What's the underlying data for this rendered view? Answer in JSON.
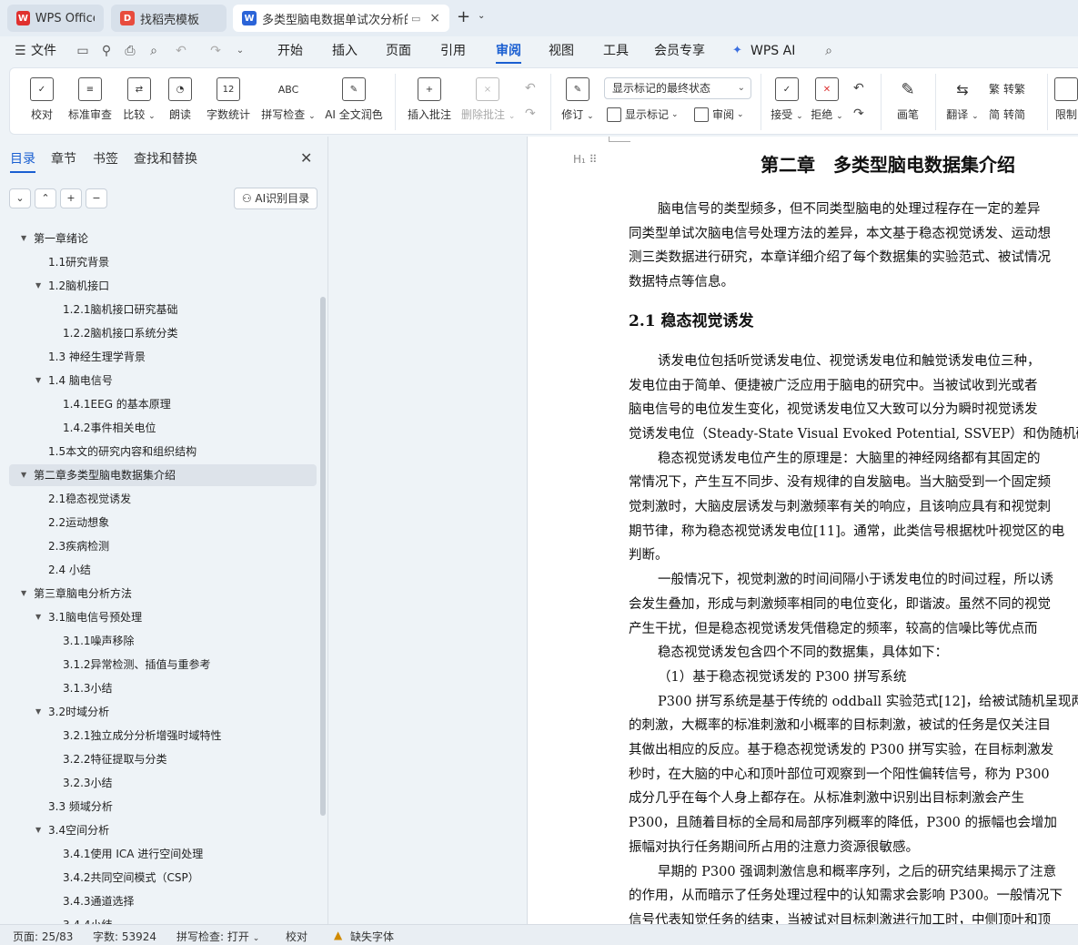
{
  "tabs": [
    {
      "label": "WPS Office",
      "icon": "wps-logo-icon"
    },
    {
      "label": "找稻壳模板",
      "icon": "docer-logo-icon"
    },
    {
      "label": "多类型脑电数据单试次分析的",
      "icon": "writer-doc-icon"
    }
  ],
  "menu": {
    "file": "文件",
    "items": [
      "开始",
      "插入",
      "页面",
      "引用",
      "审阅",
      "视图",
      "工具",
      "会员专享",
      "WPS AI"
    ],
    "active": "审阅"
  },
  "ribbon": {
    "proofread": "校对",
    "standard_review": "标准审查",
    "compare": "比较",
    "read_aloud": "朗读",
    "word_count": "字数统计",
    "spell_check": "拼写检查",
    "ai_polish": "AI 全文润色",
    "insert_comment": "插入批注",
    "delete_comment": "删除批注",
    "revise": "修订",
    "markup_mode": "显示标记的最终状态",
    "show_markup": "显示标记",
    "review": "审阅",
    "accept": "接受",
    "reject": "拒绝",
    "brush": "画笔",
    "translate": "翻译",
    "to_traditional": "转繁",
    "to_simplified": "转简",
    "restrict": "限制"
  },
  "nav": {
    "tabs": [
      "目录",
      "章节",
      "书签",
      "查找和替换"
    ],
    "ai_toc": "AI识别目录",
    "toc": [
      "第一章绪论",
      "1.1研究背景",
      "1.2脑机接口",
      "1.2.1脑机接口研究基础",
      "1.2.2脑机接口系统分类",
      "1.3  神经生理学背景",
      "1.4  脑电信号",
      "1.4.1EEG 的基本原理",
      "1.4.2事件相关电位",
      "1.5本文的研究内容和组织结构",
      "第二章多类型脑电数据集介绍",
      "2.1稳态视觉诱发",
      "2.2运动想象",
      "2.3疾病检测",
      "2.4  小结",
      "第三章脑电分析方法",
      "3.1脑电信号预处理",
      "3.1.1噪声移除",
      "3.1.2异常检测、插值与重参考",
      "3.1.3小结",
      "3.2时域分析",
      "3.2.1独立成分分析增强时域特性",
      "3.2.2特征提取与分类",
      "3.2.3小结",
      "3.3  频域分析",
      "3.4空间分析",
      "3.4.1使用 ICA 进行空间处理",
      "3.4.2共同空间模式（CSP）",
      "3.4.3通道选择",
      "3.4.4小结"
    ]
  },
  "doc": {
    "chapter_title": "第二章　多类型脑电数据集介绍",
    "section_title": "2.1 稳态视觉诱发",
    "para1": [
      "脑电信号的类型频多，但不同类型脑电的处理过程存在一定的差异",
      "同类型单试次脑电信号处理方法的差异，本文基于稳态视觉诱发、运动想",
      "测三类数据进行研究，本章详细介绍了每个数据集的实验范式、被试情况",
      "数据特点等信息。"
    ],
    "para2": [
      "诱发电位包括听觉诱发电位、视觉诱发电位和触觉诱发电位三种，",
      "发电位由于简单、便捷被广泛应用于脑电的研究中。当被试收到光或者",
      "脑电信号的电位发生变化，视觉诱发电位又大致可以分为瞬时视觉诱发",
      "觉诱发电位（Steady-State Visual Evoked Potential, SSVEP）和伪随机码视"
    ],
    "para3": [
      "稳态视觉诱发电位产生的原理是：大脑里的神经网络都有其固定的",
      "常情况下，产生互不同步、没有规律的自发脑电。当大脑受到一个固定频",
      "觉刺激时，大脑皮层诱发与刺激频率有关的响应，且该响应具有和视觉刺",
      "期节律，称为稳态视觉诱发电位[11]。通常，此类信号根据枕叶视觉区的电",
      "判断。"
    ],
    "para4": [
      "一般情况下，视觉刺激的时间间隔小于诱发电位的时间过程，所以诱",
      "会发生叠加，形成与刺激频率相同的电位变化，即谐波。虽然不同的视觉",
      "产生干扰，但是稳态视觉诱发凭借稳定的频率，较高的信噪比等优点而"
    ],
    "para5": "稳态视觉诱发包含四个不同的数据集，具体如下：",
    "para6": "（1）基于稳态视觉诱发的 P300 拼写系统",
    "para7": [
      "P300 拼写系统是基于传统的 oddball 实验范式[12]，给被试随机呈现两",
      "的刺激，大概率的标准刺激和小概率的目标刺激，被试的任务是仅关注目",
      "其做出相应的反应。基于稳态视觉诱发的 P300 拼写实验，在目标刺激发",
      "秒时，在大脑的中心和顶叶部位可观察到一个阳性偏转信号，称为 P300",
      "成分几乎在每个人身上都存在。从标准刺激中识别出目标刺激会产生",
      "P300，且随着目标的全局和局部序列概率的降低，P300 的振幅也会增加",
      "振幅对执行任务期间所占用的注意力资源很敏感。"
    ],
    "para8": [
      "早期的 P300 强调刺激信息和概率序列，之后的研究结果揭示了注意",
      "的作用，从而暗示了任务处理过程中的认知需求会影响 P300。一般情况下",
      "信号代表知觉任务的结束，当被试对目标刺激进行加工时，中侧顶叶和顶"
    ]
  },
  "status": {
    "page": "页面: 25/83",
    "words": "字数: 53924",
    "spell": "拼写检查: 打开",
    "proof": "校对",
    "missing_font": "缺失字体"
  }
}
